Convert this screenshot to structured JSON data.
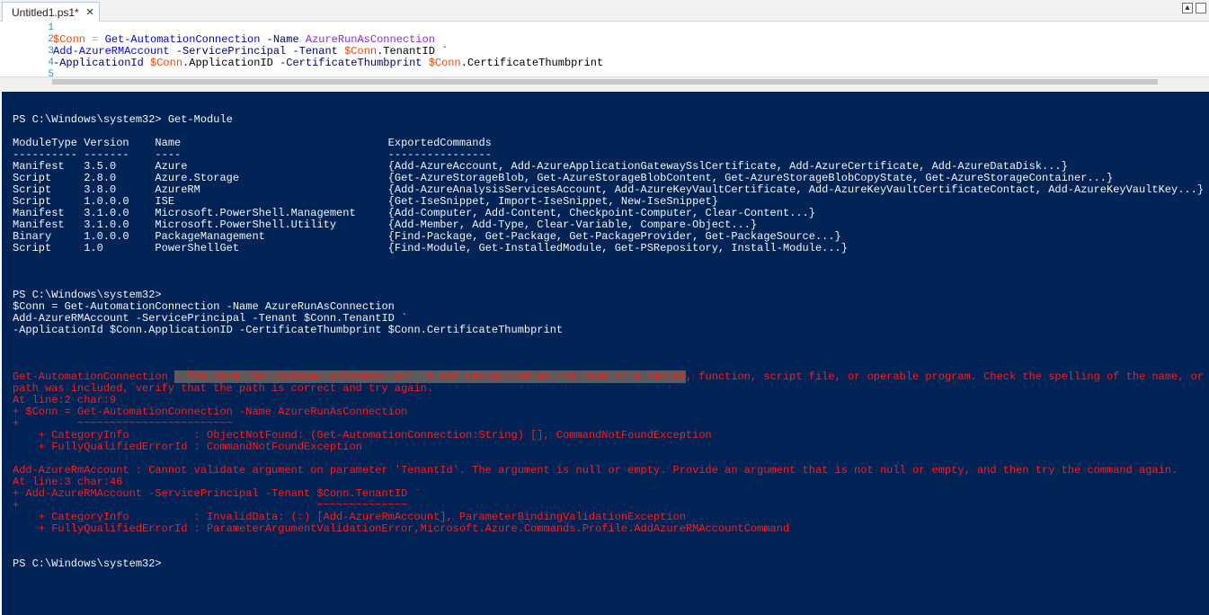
{
  "tab": {
    "title": "Untitled1.ps1*",
    "close_glyph": "×"
  },
  "window_controls": {
    "collapse_glyph": "▲"
  },
  "editor": {
    "line_numbers": [
      "1",
      "2",
      "3",
      "4",
      "5"
    ],
    "line2": {
      "var": "$Conn",
      "eq": " = ",
      "cmd": "Get-AutomationConnection",
      "param": " -Name ",
      "arg": "AzureRunAsConnection"
    },
    "line3": {
      "cmd": "Add-AzureRMAccount",
      "param1": " -ServicePrincipal",
      "param2": " -Tenant ",
      "var": "$Conn",
      "prop": ".TenantID",
      "backtick": " `"
    },
    "line4": {
      "param1": "-ApplicationId ",
      "var1": "$Conn",
      "prop1": ".ApplicationID",
      "param2": " -CertificateThumbprint ",
      "var2": "$Conn",
      "prop2": ".CertificateThumbprint"
    }
  },
  "console": {
    "lines": [
      "PS C:\\Windows\\system32> Get-Module",
      "ModuleType Version    Name                                ExportedCommands",
      "---------- -------    ----                                ----------------",
      "Manifest   3.5.0      Azure                               {Add-AzureAccount, Add-AzureApplicationGatewaySslCertificate, Add-AzureCertificate, Add-AzureDataDisk...}",
      "Script     2.8.0      Azure.Storage                       {Get-AzureStorageBlob, Get-AzureStorageBlobContent, Get-AzureStorageBlobCopyState, Get-AzureStorageContainer...}",
      "Script     3.8.0      AzureRM                             {Add-AzureAnalysisServicesAccount, Add-AzureKeyVaultCertificate, Add-AzureKeyVaultCertificateContact, Add-AzureKeyVaultKey...}",
      "Script     1.0.0.0    ISE                                 {Get-IseSnippet, Import-IseSnippet, New-IseSnippet}",
      "Manifest   3.1.0.0    Microsoft.PowerShell.Management     {Add-Computer, Add-Content, Checkpoint-Computer, Clear-Content...}",
      "Manifest   3.1.0.0    Microsoft.PowerShell.Utility        {Add-Member, Add-Type, Clear-Variable, Compare-Object...}",
      "Binary     1.0.0.0    PackageManagement                   {Find-Package, Get-Package, Get-PackageProvider, Get-PackageSource...}",
      "Script     1.0        PowerShellGet                       {Find-Module, Get-InstalledModule, Get-PSRepository, Install-Module...}",
      "PS C:\\Windows\\system32>",
      "$Conn = Get-AutomationConnection -Name AzureRunAsConnection",
      "Add-AzureRMAccount -ServicePrincipal -Tenant $Conn.TenantID `",
      "-ApplicationId $Conn.ApplicationID -CertificateThumbprint $Conn.CertificateThumbprint",
      "PS C:\\Windows\\system32>"
    ],
    "errors": {
      "e1_prefix": "Get-AutomationConnection ",
      "e1_highlight": ": The term 'Get-AutomationConnection' is not recognized as the name of a cmdlet",
      "e1_rest": ", function, script file, or operable program. Check the spelling of the name, or if a",
      "e2": "path was included, verify that the path is correct and try again.",
      "e3": "At line:2 char:9",
      "e4": "+ $Conn = Get-AutomationConnection -Name AzureRunAsConnection",
      "e5": "+         ~~~~~~~~~~~~~~~~~~~~~~~~",
      "e6": "    + CategoryInfo          : ObjectNotFound: (Get-AutomationConnection:String) [], CommandNotFoundException",
      "e7": "    + FullyQualifiedErrorId : CommandNotFoundException",
      "e8": "Add-AzureRmAccount : Cannot validate argument on parameter 'TenantId'. The argument is null or empty. Provide an argument that is not null or empty, and then try the command again.",
      "e9": "At line:3 char:46",
      "e10": "+ Add-AzureRMAccount -ServicePrincipal -Tenant $Conn.TenantID `",
      "e11": "+                                              ~~~~~~~~~~~~~~",
      "e12": "    + CategoryInfo          : InvalidData: (:) [Add-AzureRmAccount], ParameterBindingValidationException",
      "e13": "    + FullyQualifiedErrorId : ParameterArgumentValidationError,Microsoft.Azure.Commands.Profile.AddAzureRMAccountCommand"
    }
  },
  "colors": {
    "console_bg": "#012456",
    "console_text": "#f5f5f5",
    "error_text": "#ff1a1a",
    "error_highlight": "#5b5b5b",
    "editor_variable": "#ff4500",
    "editor_command": "#0000ff",
    "editor_parameter": "#000080",
    "editor_argument": "#8a2be2",
    "line_number": "#2b91af"
  }
}
